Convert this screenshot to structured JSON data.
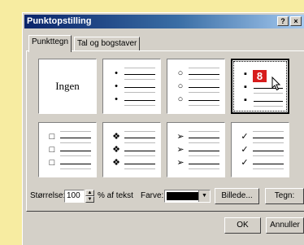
{
  "window": {
    "title": "Punktopstilling",
    "help_label": "?",
    "close_label": "×"
  },
  "tabs": [
    {
      "label": "Punkttegn",
      "active": true
    },
    {
      "label": "Tal og bogstaver",
      "active": false
    }
  ],
  "bullet_styles": [
    {
      "label": "Ingen"
    },
    {
      "glyph": "•"
    },
    {
      "glyph": "○"
    },
    {
      "glyph": "▪",
      "selected": true
    },
    {
      "glyph": "□"
    },
    {
      "glyph": "❖"
    },
    {
      "glyph": "➢"
    },
    {
      "glyph": "✓"
    }
  ],
  "overlay_badge": "8",
  "size": {
    "label": "Størrelse:",
    "value": "100",
    "unit_label": "% af tekst"
  },
  "color": {
    "label": "Farve:",
    "swatch": "#000000"
  },
  "buttons": {
    "picture": "Billede...",
    "character": "Tegn:",
    "ok": "OK",
    "cancel": "Annuller"
  }
}
